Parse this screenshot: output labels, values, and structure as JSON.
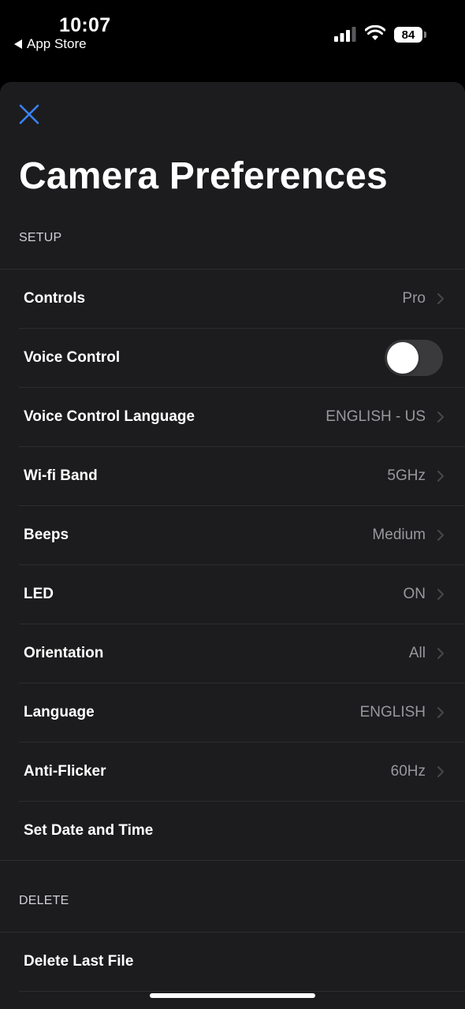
{
  "status_bar": {
    "time": "10:07",
    "back_label": "App Store",
    "battery_level": "84"
  },
  "header": {
    "title": "Camera Preferences"
  },
  "sections": {
    "setup": {
      "header": "SETUP",
      "rows": [
        {
          "label": "Controls",
          "value": "Pro"
        },
        {
          "label": "Voice Control",
          "toggle": false
        },
        {
          "label": "Voice Control Language",
          "value": "ENGLISH - US"
        },
        {
          "label": "Wi-fi Band",
          "value": "5GHz"
        },
        {
          "label": "Beeps",
          "value": "Medium"
        },
        {
          "label": "LED",
          "value": "ON"
        },
        {
          "label": "Orientation",
          "value": "All"
        },
        {
          "label": "Language",
          "value": "ENGLISH"
        },
        {
          "label": "Anti-Flicker",
          "value": "60Hz"
        },
        {
          "label": "Set Date and Time"
        }
      ]
    },
    "delete": {
      "header": "DELETE",
      "rows": [
        {
          "label": "Delete Last File"
        }
      ]
    }
  },
  "colors": {
    "accent": "#3b82f6",
    "background": "#000000",
    "sheet": "#1c1c1e",
    "secondary_text": "#98989d"
  }
}
